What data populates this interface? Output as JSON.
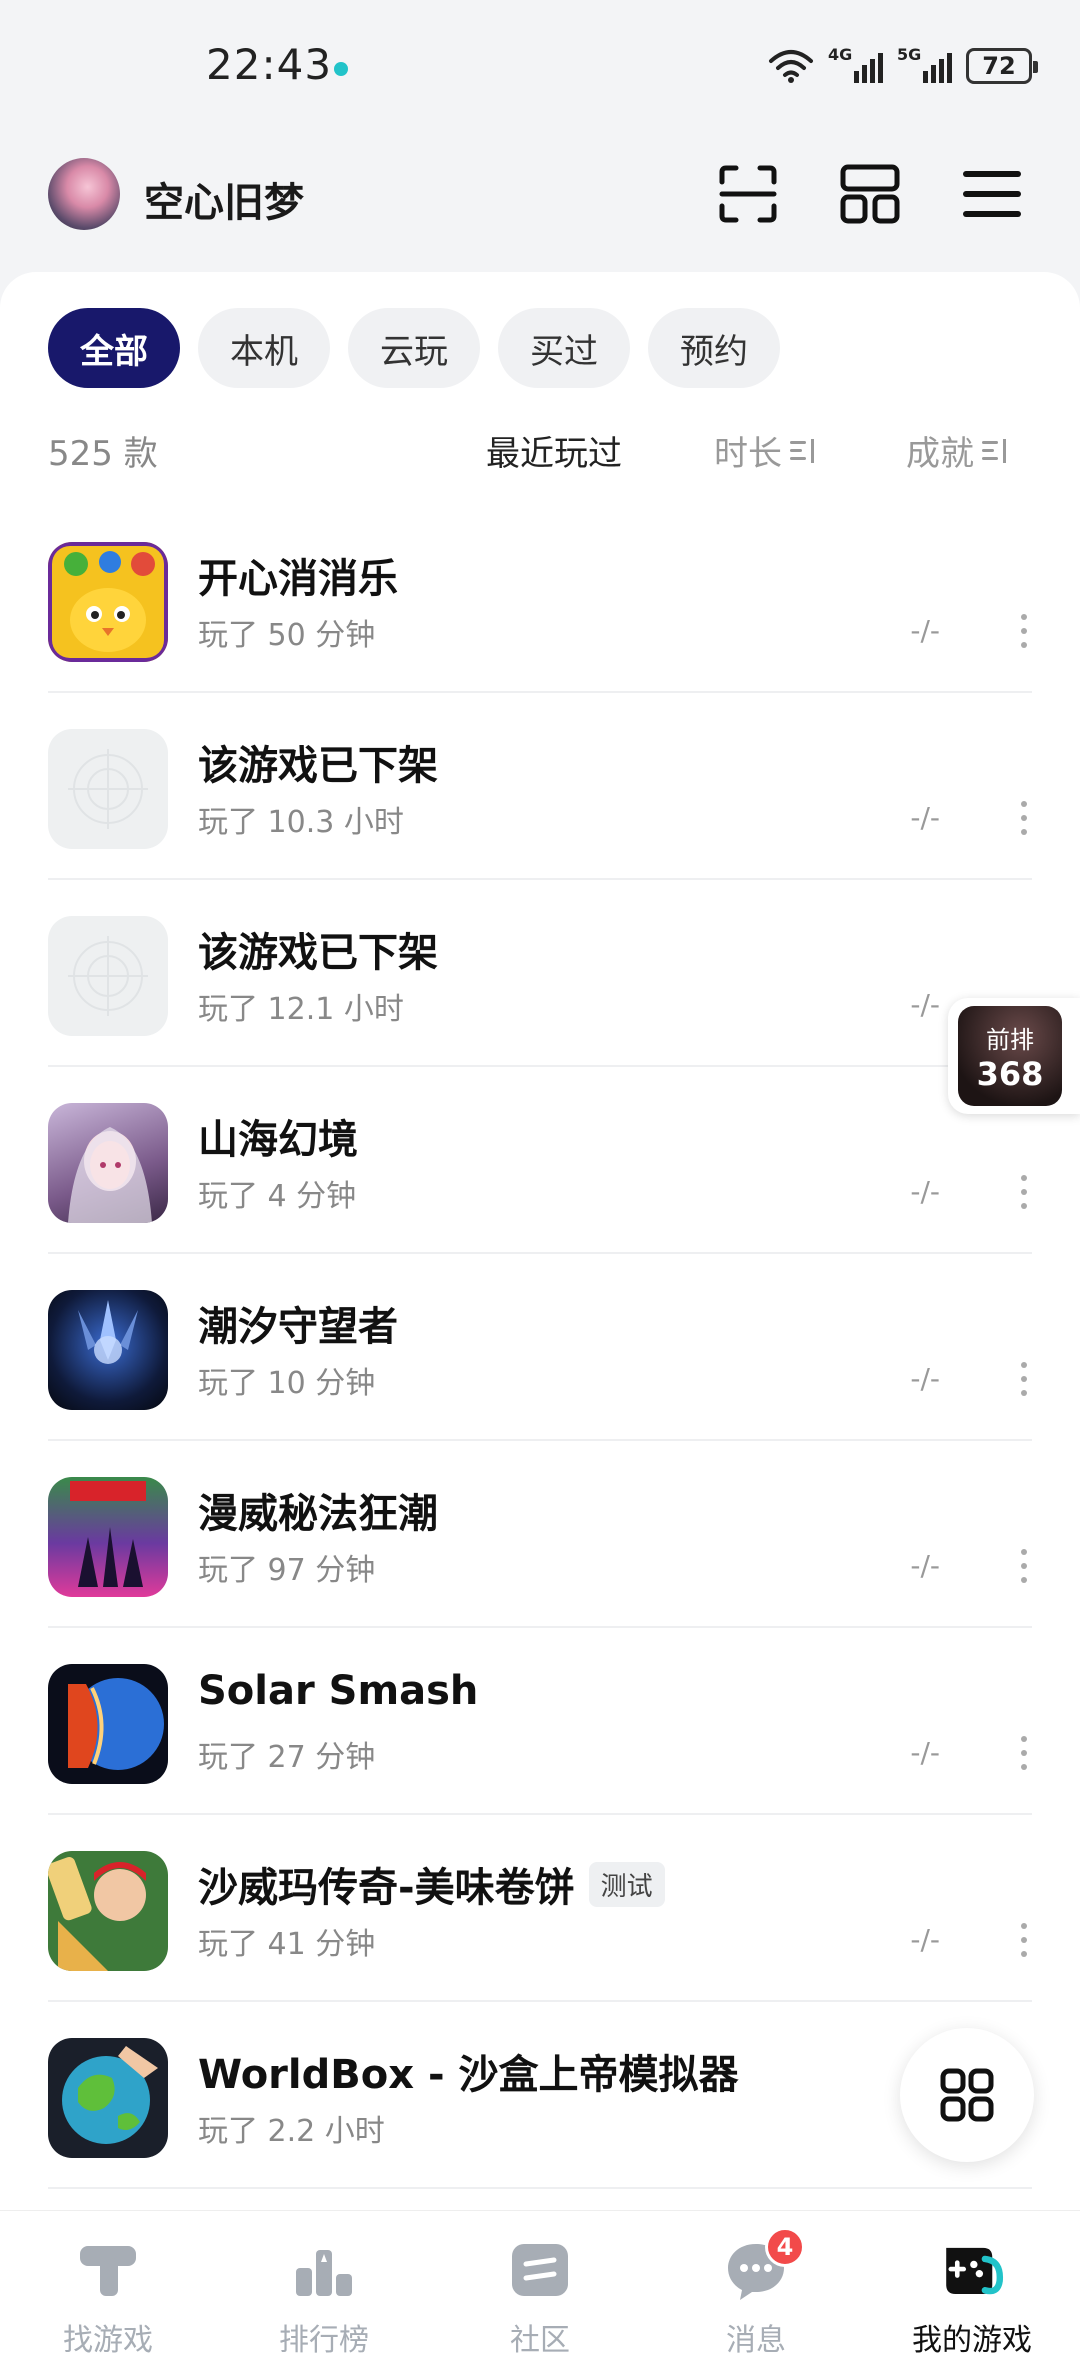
{
  "status_bar": {
    "time": "22:43",
    "net1": "4G",
    "net2": "5G",
    "battery": "72"
  },
  "header": {
    "username": "空心旧梦"
  },
  "filters": [
    "全部",
    "本机",
    "云玩",
    "买过",
    "预约"
  ],
  "sort": {
    "count": "525 款",
    "recent": "最近玩过",
    "duration": "时长",
    "achievement": "成就"
  },
  "games": [
    {
      "title": "开心消消乐",
      "play": "玩了 50 分钟",
      "achievement": "-/-",
      "tag": ""
    },
    {
      "title": "该游戏已下架",
      "play": "玩了 10.3 小时",
      "achievement": "-/-",
      "tag": ""
    },
    {
      "title": "该游戏已下架",
      "play": "玩了 12.1 小时",
      "achievement": "-/-",
      "tag": ""
    },
    {
      "title": "山海幻境",
      "play": "玩了 4 分钟",
      "achievement": "-/-",
      "tag": ""
    },
    {
      "title": "潮汐守望者",
      "play": "玩了 10 分钟",
      "achievement": "-/-",
      "tag": ""
    },
    {
      "title": "漫威秘法狂潮",
      "play": "玩了 97 分钟",
      "achievement": "-/-",
      "tag": ""
    },
    {
      "title": "Solar Smash",
      "play": "玩了 27 分钟",
      "achievement": "-/-",
      "tag": ""
    },
    {
      "title": "沙威玛传奇-美味卷饼",
      "play": "玩了 41 分钟",
      "achievement": "-/-",
      "tag": "测试"
    },
    {
      "title": "WorldBox - 沙盒上帝模拟器",
      "play": "玩了 2.2 小时",
      "achievement": "",
      "tag": ""
    }
  ],
  "float_rank": {
    "label": "前排",
    "value": "368"
  },
  "bottom_nav": {
    "items": [
      {
        "label": "找游戏"
      },
      {
        "label": "排行榜"
      },
      {
        "label": "社区"
      },
      {
        "label": "消息",
        "badge": "4"
      },
      {
        "label": "我的游戏"
      }
    ]
  },
  "colors": {
    "accent": "#18186b",
    "teal": "#22c3c9",
    "badge": "#f24a4a"
  }
}
